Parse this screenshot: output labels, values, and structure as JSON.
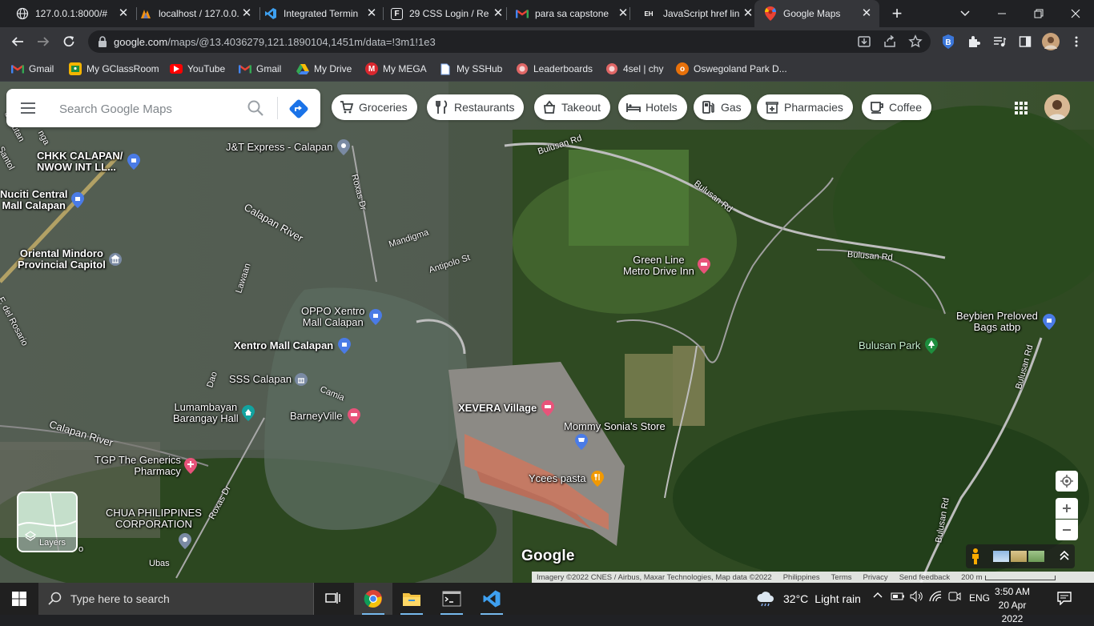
{
  "browser": {
    "tabs": [
      {
        "title": "127.0.0.1:8000/#",
        "favicon": "globe-icon",
        "active": false
      },
      {
        "title": "localhost / 127.0.0.",
        "favicon": "phpmyadmin-icon",
        "active": false
      },
      {
        "title": "Integrated Termin",
        "favicon": "vscode-icon",
        "active": false
      },
      {
        "title": "29 CSS Login / Re",
        "favicon": "f-logo-icon",
        "active": false
      },
      {
        "title": "para sa capstone",
        "favicon": "gmail-icon",
        "active": false
      },
      {
        "title": "JavaScript href lin",
        "favicon": "eh-icon",
        "favicon_text": "EH",
        "active": false
      },
      {
        "title": "Google Maps",
        "favicon": "google-maps-icon",
        "active": true
      }
    ],
    "url_host": "google.com",
    "url_path": "/maps/@13.4036279,121.1890104,1451m/data=!3m1!1e3",
    "bookmarks": [
      {
        "label": "Gmail",
        "icon": "gmail-icon",
        "color": "#ea4335"
      },
      {
        "label": "My GClassRoom",
        "icon": "classroom-icon",
        "color": "#f4b400"
      },
      {
        "label": "YouTube",
        "icon": "youtube-icon",
        "color": "#ff0000"
      },
      {
        "label": "Gmail",
        "icon": "gmail-icon",
        "color": "#ea4335"
      },
      {
        "label": "My Drive",
        "icon": "drive-icon",
        "color": "#34a853"
      },
      {
        "label": "My MEGA",
        "icon": "mega-icon",
        "color": "#d9272e"
      },
      {
        "label": "My SSHub",
        "icon": "page-icon",
        "color": "#8ab4f8"
      },
      {
        "label": "Leaderboards",
        "icon": "leaderboards-icon",
        "color": "#e06666"
      },
      {
        "label": "4sel | chy",
        "icon": "4sel-icon",
        "color": "#e06666"
      },
      {
        "label": "Oswegoland Park D...",
        "icon": "oswegoland-icon",
        "color": "#e8710a"
      }
    ]
  },
  "maps": {
    "search_placeholder": "Search Google Maps",
    "chips": [
      {
        "label": "Groceries",
        "icon": "cart-icon"
      },
      {
        "label": "Restaurants",
        "icon": "fork-knife-icon"
      },
      {
        "label": "Takeout",
        "icon": "takeout-bag-icon"
      },
      {
        "label": "Hotels",
        "icon": "bed-icon"
      },
      {
        "label": "Gas",
        "icon": "gas-pump-icon"
      },
      {
        "label": "Pharmacies",
        "icon": "pharmacy-icon"
      },
      {
        "label": "Coffee",
        "icon": "coffee-cup-icon"
      }
    ],
    "pois": [
      {
        "label": "CHKK CALAPAN/\nNWOW INT LL...",
        "kind": "shopping",
        "bold": true
      },
      {
        "label": "J&T Express - Calapan",
        "kind": "generic",
        "bold": false
      },
      {
        "label": "Nuciti Central\nMall Calapan",
        "kind": "shopping",
        "bold": true
      },
      {
        "label": "Oriental Mindoro\nProvincial Capitol",
        "kind": "government",
        "bold": true
      },
      {
        "label": "OPPO Xentro\nMall Calapan",
        "kind": "shopping",
        "bold": false
      },
      {
        "label": "Xentro Mall Calapan",
        "kind": "shopping",
        "bold": true
      },
      {
        "label": "SSS Calapan",
        "kind": "government",
        "bold": false
      },
      {
        "label": "Lumambayan\nBarangay Hall",
        "kind": "civic",
        "bold": false
      },
      {
        "label": "BarneyVille",
        "kind": "lodging",
        "bold": false
      },
      {
        "label": "TGP The Generics\nPharmacy",
        "kind": "pharmacy",
        "bold": false
      },
      {
        "label": "CHUA PHILIPPINES\nCORPORATION",
        "kind": "generic",
        "bold": false
      },
      {
        "label": "XEVERA Village",
        "kind": "lodging",
        "bold": true
      },
      {
        "label": "Mommy Sonia's Store",
        "kind": "shopping",
        "bold": false
      },
      {
        "label": "Ycees pasta",
        "kind": "food",
        "bold": false
      },
      {
        "label": "Green Line\nMetro Drive Inn",
        "kind": "lodging",
        "bold": false
      },
      {
        "label": "Beybien Preloved\nBags atbp",
        "kind": "shopping",
        "bold": false
      },
      {
        "label": "Bulusan Park",
        "kind": "park",
        "bold": false
      }
    ],
    "roads": [
      "Bulusan Rd",
      "Bulusan Rd",
      "Bulusan Rd",
      "Bulusan Rd",
      "Bulusan Rd",
      "Roxas Dr",
      "Roxas Dr",
      "Calapan River",
      "Calapan River",
      "Mandigma",
      "Antipolo St",
      "Lawaan",
      "F. del Rosario",
      "Dao",
      "Camia",
      "Ubas",
      "Santol",
      "Sabutan",
      "nga",
      "o"
    ],
    "layers_label": "Layers",
    "logo": "Google",
    "footer": {
      "imagery": "Imagery ©2022 CNES / Airbus, Maxar Technologies, Map data ©2022",
      "country": "Philippines",
      "terms": "Terms",
      "privacy": "Privacy",
      "feedback": "Send feedback",
      "scale": "200 m"
    }
  },
  "taskbar": {
    "search_placeholder": "Type here to search",
    "weather_temp": "32°C",
    "weather_text": "Light rain",
    "language": "ENG",
    "time": "3:50 AM",
    "date": "20 Apr 2022"
  }
}
